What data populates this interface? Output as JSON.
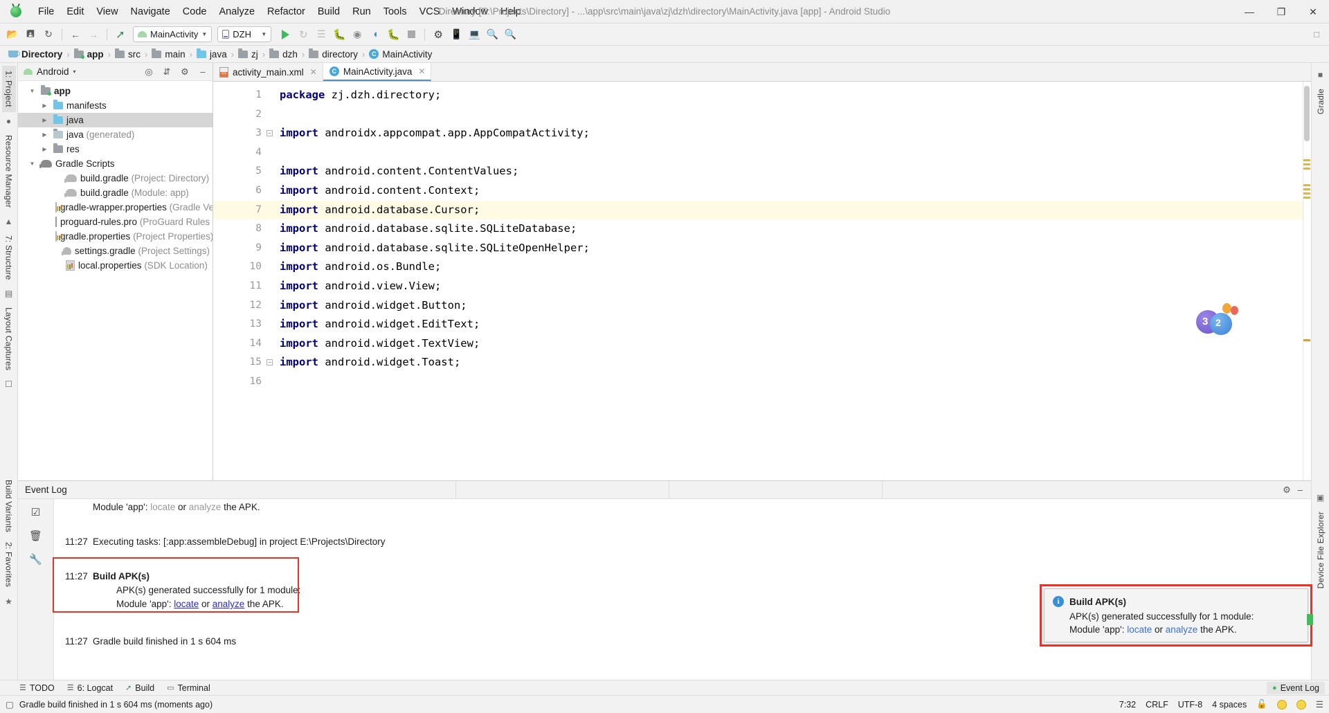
{
  "window": {
    "title": "Directory [E:\\Projects\\Directory] - ...\\app\\src\\main\\java\\zj\\dzh\\directory\\MainActivity.java [app] - Android Studio",
    "minimize": "—",
    "maximize": "❐",
    "close": "✕"
  },
  "menu": [
    "File",
    "Edit",
    "View",
    "Navigate",
    "Code",
    "Analyze",
    "Refactor",
    "Build",
    "Run",
    "Tools",
    "VCS",
    "Window",
    "Help"
  ],
  "toolbar": {
    "run_config": "MainActivity",
    "device": "DZH",
    "icons": [
      "open-folder-icon",
      "save-all-icon",
      "sync-project-icon",
      "back-icon",
      "forward-icon",
      "build-hammer-icon",
      "run-icon",
      "apply-changes-icon",
      "apply-code-changes-icon",
      "debug-icon",
      "run-with-coverage-icon",
      "profiler-icon",
      "attach-debugger-icon",
      "stop-icon",
      "sdk-manager-icon",
      "avd-manager-icon",
      "device-file-explorer-icon",
      "search-icon"
    ]
  },
  "breadcrumb": [
    {
      "label": "Directory",
      "icon": "project-icon",
      "bold": true
    },
    {
      "label": "app",
      "icon": "module-folder-icon",
      "bold": true
    },
    {
      "label": "src",
      "icon": "folder-icon",
      "bold": false
    },
    {
      "label": "main",
      "icon": "folder-icon",
      "bold": false
    },
    {
      "label": "java",
      "icon": "source-folder-icon",
      "bold": false
    },
    {
      "label": "zj",
      "icon": "package-icon",
      "bold": false
    },
    {
      "label": "dzh",
      "icon": "package-icon",
      "bold": false
    },
    {
      "label": "directory",
      "icon": "package-icon",
      "bold": false
    },
    {
      "label": "MainActivity",
      "icon": "class-icon",
      "bold": false
    }
  ],
  "left_rail": {
    "tabs": [
      "1: Project",
      "Resource Manager",
      "7: Structure",
      "Layout Captures",
      "Build Variants",
      "2: Favorites"
    ]
  },
  "right_rail": {
    "tabs": [
      "Gradle",
      "Device File Explorer"
    ]
  },
  "project_panel": {
    "title": "Android",
    "caret": "▾",
    "actions": [
      "select-opened-file-icon",
      "collapse-all-icon",
      "settings-gear-icon",
      "hide-icon"
    ],
    "tree": [
      {
        "indent": 0,
        "twisty": "▼",
        "icon": "module-folder-icon",
        "label": "app",
        "bold": true,
        "dim": "",
        "selected": false
      },
      {
        "indent": 1,
        "twisty": "▶",
        "icon": "folder-blue-icon",
        "label": "manifests",
        "bold": false,
        "dim": "",
        "selected": false
      },
      {
        "indent": 1,
        "twisty": "▶",
        "icon": "folder-blue-icon",
        "label": "java",
        "bold": false,
        "dim": "",
        "selected": true
      },
      {
        "indent": 1,
        "twisty": "▶",
        "icon": "folder-generated-icon",
        "label": "java",
        "bold": false,
        "dim": "(generated)",
        "selected": false
      },
      {
        "indent": 1,
        "twisty": "▶",
        "icon": "folder-res-icon",
        "label": "res",
        "bold": false,
        "dim": "",
        "selected": false
      },
      {
        "indent": 0,
        "twisty": "▼",
        "icon": "gradle-elephant-icon",
        "label": "Gradle Scripts",
        "bold": false,
        "dim": "",
        "selected": false
      },
      {
        "indent": 2,
        "twisty": "",
        "icon": "gradle-file-icon",
        "label": "build.gradle",
        "bold": false,
        "dim": "(Project: Directory)",
        "selected": false
      },
      {
        "indent": 2,
        "twisty": "",
        "icon": "gradle-file-icon",
        "label": "build.gradle",
        "bold": false,
        "dim": "(Module: app)",
        "selected": false
      },
      {
        "indent": 2,
        "twisty": "",
        "icon": "properties-file-icon",
        "label": "gradle-wrapper.properties",
        "bold": false,
        "dim": "(Gradle Ve",
        "selected": false
      },
      {
        "indent": 2,
        "twisty": "",
        "icon": "text-file-icon",
        "label": "proguard-rules.pro",
        "bold": false,
        "dim": "(ProGuard Rules fo",
        "selected": false
      },
      {
        "indent": 2,
        "twisty": "",
        "icon": "properties-file-icon",
        "label": "gradle.properties",
        "bold": false,
        "dim": "(Project Properties)",
        "selected": false
      },
      {
        "indent": 2,
        "twisty": "",
        "icon": "gradle-file-icon",
        "label": "settings.gradle",
        "bold": false,
        "dim": "(Project Settings)",
        "selected": false
      },
      {
        "indent": 2,
        "twisty": "",
        "icon": "properties-file-icon",
        "label": "local.properties",
        "bold": false,
        "dim": "(SDK Location)",
        "selected": false
      }
    ]
  },
  "editor": {
    "tabs": [
      {
        "label": "activity_main.xml",
        "icon": "xml-layout-icon",
        "active": false,
        "close": "✕"
      },
      {
        "label": "MainActivity.java",
        "icon": "java-class-icon",
        "active": true,
        "close": "✕"
      }
    ],
    "highlight_line": 7,
    "lines": [
      {
        "n": 1,
        "fold": "",
        "code": "package zj.dzh.directory;",
        "kw": "package"
      },
      {
        "n": 2,
        "fold": "",
        "code": "",
        "kw": ""
      },
      {
        "n": 3,
        "fold": "minus",
        "code": "import androidx.appcompat.app.AppCompatActivity;",
        "kw": "import"
      },
      {
        "n": 4,
        "fold": "",
        "code": "",
        "kw": ""
      },
      {
        "n": 5,
        "fold": "",
        "code": "import android.content.ContentValues;",
        "kw": "import"
      },
      {
        "n": 6,
        "fold": "",
        "code": "import android.content.Context;",
        "kw": "import"
      },
      {
        "n": 7,
        "fold": "",
        "code": "import android.database.Cursor;",
        "kw": "import"
      },
      {
        "n": 8,
        "fold": "",
        "code": "import android.database.sqlite.SQLiteDatabase;",
        "kw": "import"
      },
      {
        "n": 9,
        "fold": "",
        "code": "import android.database.sqlite.SQLiteOpenHelper;",
        "kw": "import"
      },
      {
        "n": 10,
        "fold": "",
        "code": "import android.os.Bundle;",
        "kw": "import"
      },
      {
        "n": 11,
        "fold": "",
        "code": "import android.view.View;",
        "kw": "import"
      },
      {
        "n": 12,
        "fold": "",
        "code": "import android.widget.Button;",
        "kw": "import"
      },
      {
        "n": 13,
        "fold": "",
        "code": "import android.widget.EditText;",
        "kw": "import"
      },
      {
        "n": 14,
        "fold": "",
        "code": "import android.widget.TextView;",
        "kw": "import"
      },
      {
        "n": 15,
        "fold": "minus",
        "code": "import android.widget.Toast;",
        "kw": "import"
      },
      {
        "n": 16,
        "fold": "",
        "code": "",
        "kw": ""
      }
    ],
    "badge": {
      "left_number": "3",
      "right_number": "2"
    }
  },
  "event_log": {
    "title": "Event Log",
    "settings_icon": "gear-icon",
    "hide_icon": "minimize-icon",
    "rail_icons": [
      "mark-read-icon",
      "delete-icon",
      "settings-wrench-icon"
    ],
    "entries": [
      {
        "time": "",
        "text_parts": [
          {
            "t": "Module 'app': ",
            "style": "plain"
          },
          {
            "t": "locate",
            "style": "link-grey"
          },
          {
            "t": " or ",
            "style": "plain"
          },
          {
            "t": "analyze",
            "style": "link-grey"
          },
          {
            "t": " the APK.",
            "style": "plain"
          }
        ],
        "clipped": true
      },
      {
        "time": "11:27",
        "text_parts": [
          {
            "t": "Executing tasks: [:app:assembleDebug] in project E:\\Projects\\Directory",
            "style": "plain"
          }
        ]
      },
      {
        "time": "11:27",
        "title": "Build APK(s)",
        "boxed": true,
        "lines": [
          [
            {
              "t": "APK(s) generated successfully for 1 module:",
              "style": "plain"
            }
          ],
          [
            {
              "t": "Module 'app': ",
              "style": "plain"
            },
            {
              "t": "locate",
              "style": "link-blue"
            },
            {
              "t": " or ",
              "style": "plain"
            },
            {
              "t": "analyze",
              "style": "link-blue"
            },
            {
              "t": " the APK.",
              "style": "plain"
            }
          ]
        ]
      },
      {
        "time": "11:27",
        "text_parts": [
          {
            "t": "Gradle build finished in 1 s 604 ms",
            "style": "plain"
          }
        ]
      }
    ]
  },
  "popup": {
    "icon": "info-icon",
    "title": "Build APK(s)",
    "line1": "APK(s) generated successfully for 1 module:",
    "line2_pre": "Module 'app': ",
    "link1": "locate",
    "line2_mid": " or ",
    "link2": "analyze",
    "line2_post": " the APK."
  },
  "bottom_tabs": [
    {
      "label": "TODO",
      "icon": "todo-icon"
    },
    {
      "label": "6: Logcat",
      "icon": "logcat-icon"
    },
    {
      "label": "Build",
      "icon": "build-hammer-icon"
    },
    {
      "label": "Terminal",
      "icon": "terminal-icon"
    }
  ],
  "bottom_right_tab": {
    "label": "Event Log",
    "icon": "event-log-icon"
  },
  "status_bar": {
    "message": "Gradle build finished in 1 s 604 ms (moments ago)",
    "caret": "7:32",
    "line_separator": "CRLF",
    "encoding": "UTF-8",
    "indent": "4 spaces",
    "lock_icon": "read-write-lock-icon",
    "inspection_icon": "inspection-smiley-icon",
    "notify_icon": "notification-smiley-icon",
    "memory_icon": "memory-icon"
  },
  "colors": {
    "accent_blue": "#4a90d9",
    "highlight_red": "#ee3124",
    "android_green": "#3ebb5c",
    "link_blue": "#2a2ad8",
    "keyword_navy": "#000080",
    "line_highlight": "#fffae3"
  }
}
